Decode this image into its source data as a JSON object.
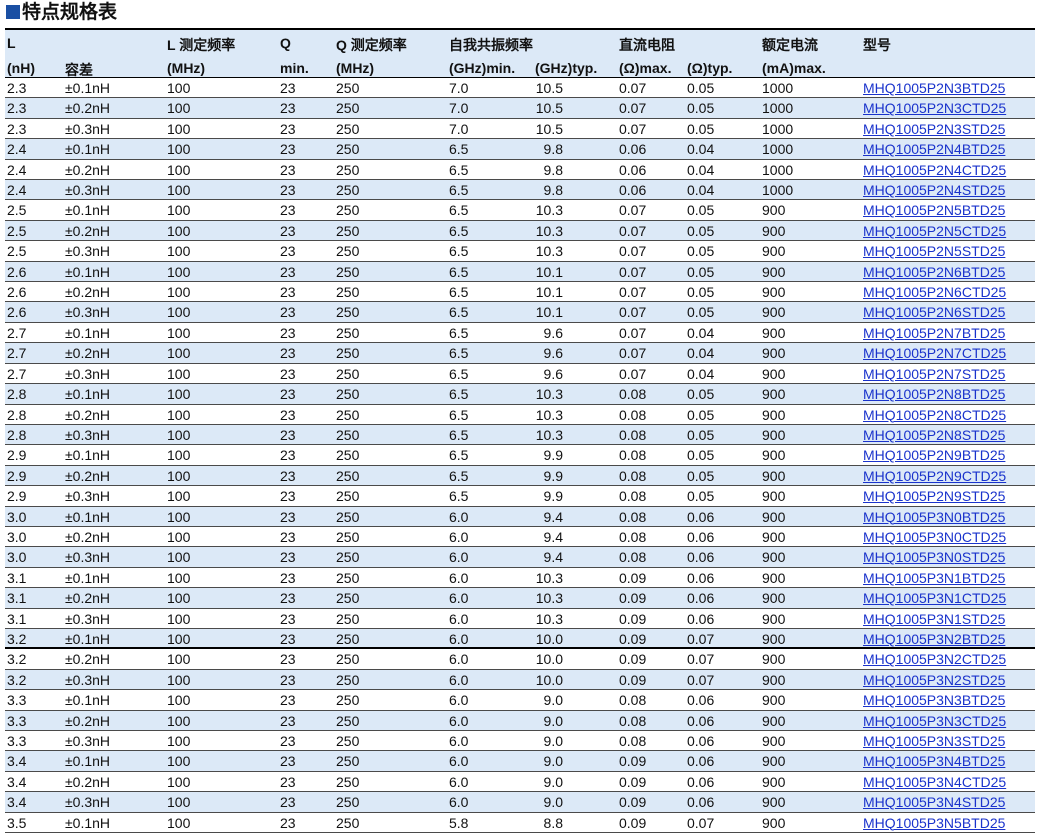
{
  "title": "特点规格表",
  "header": {
    "row1": {
      "l": "L",
      "l_freq": "L 测定频率",
      "q": "Q",
      "q_freq": "Q 测定频率",
      "srf": "自我共振频率",
      "dcr": "直流电阻",
      "rated": "额定电流",
      "part": "型号"
    },
    "row2": {
      "l_unit": "(nH)",
      "tol": "容差",
      "l_freq_unit": "(MHz)",
      "q_min": "min.",
      "q_freq_unit": "(MHz)",
      "srf_min": "(GHz)min.",
      "srf_typ": "(GHz)typ.",
      "dcr_max": "(Ω)max.",
      "dcr_typ": "(Ω)typ.",
      "rated_unit": "(mA)max."
    }
  },
  "rows": [
    [
      "2.3",
      "±0.1nH",
      "100",
      "23",
      "250",
      "7.0",
      "10.5",
      "0.07",
      "0.05",
      "1000",
      "MHQ1005P2N3BTD25"
    ],
    [
      "2.3",
      "±0.2nH",
      "100",
      "23",
      "250",
      "7.0",
      "10.5",
      "0.07",
      "0.05",
      "1000",
      "MHQ1005P2N3CTD25"
    ],
    [
      "2.3",
      "±0.3nH",
      "100",
      "23",
      "250",
      "7.0",
      "10.5",
      "0.07",
      "0.05",
      "1000",
      "MHQ1005P2N3STD25"
    ],
    [
      "2.4",
      "±0.1nH",
      "100",
      "23",
      "250",
      "6.5",
      "9.8",
      "0.06",
      "0.04",
      "1000",
      "MHQ1005P2N4BTD25"
    ],
    [
      "2.4",
      "±0.2nH",
      "100",
      "23",
      "250",
      "6.5",
      "9.8",
      "0.06",
      "0.04",
      "1000",
      "MHQ1005P2N4CTD25"
    ],
    [
      "2.4",
      "±0.3nH",
      "100",
      "23",
      "250",
      "6.5",
      "9.8",
      "0.06",
      "0.04",
      "1000",
      "MHQ1005P2N4STD25"
    ],
    [
      "2.5",
      "±0.1nH",
      "100",
      "23",
      "250",
      "6.5",
      "10.3",
      "0.07",
      "0.05",
      "900",
      "MHQ1005P2N5BTD25"
    ],
    [
      "2.5",
      "±0.2nH",
      "100",
      "23",
      "250",
      "6.5",
      "10.3",
      "0.07",
      "0.05",
      "900",
      "MHQ1005P2N5CTD25"
    ],
    [
      "2.5",
      "±0.3nH",
      "100",
      "23",
      "250",
      "6.5",
      "10.3",
      "0.07",
      "0.05",
      "900",
      "MHQ1005P2N5STD25"
    ],
    [
      "2.6",
      "±0.1nH",
      "100",
      "23",
      "250",
      "6.5",
      "10.1",
      "0.07",
      "0.05",
      "900",
      "MHQ1005P2N6BTD25"
    ],
    [
      "2.6",
      "±0.2nH",
      "100",
      "23",
      "250",
      "6.5",
      "10.1",
      "0.07",
      "0.05",
      "900",
      "MHQ1005P2N6CTD25"
    ],
    [
      "2.6",
      "±0.3nH",
      "100",
      "23",
      "250",
      "6.5",
      "10.1",
      "0.07",
      "0.05",
      "900",
      "MHQ1005P2N6STD25"
    ],
    [
      "2.7",
      "±0.1nH",
      "100",
      "23",
      "250",
      "6.5",
      "9.6",
      "0.07",
      "0.04",
      "900",
      "MHQ1005P2N7BTD25"
    ],
    [
      "2.7",
      "±0.2nH",
      "100",
      "23",
      "250",
      "6.5",
      "9.6",
      "0.07",
      "0.04",
      "900",
      "MHQ1005P2N7CTD25"
    ],
    [
      "2.7",
      "±0.3nH",
      "100",
      "23",
      "250",
      "6.5",
      "9.6",
      "0.07",
      "0.04",
      "900",
      "MHQ1005P2N7STD25"
    ],
    [
      "2.8",
      "±0.1nH",
      "100",
      "23",
      "250",
      "6.5",
      "10.3",
      "0.08",
      "0.05",
      "900",
      "MHQ1005P2N8BTD25"
    ],
    [
      "2.8",
      "±0.2nH",
      "100",
      "23",
      "250",
      "6.5",
      "10.3",
      "0.08",
      "0.05",
      "900",
      "MHQ1005P2N8CTD25"
    ],
    [
      "2.8",
      "±0.3nH",
      "100",
      "23",
      "250",
      "6.5",
      "10.3",
      "0.08",
      "0.05",
      "900",
      "MHQ1005P2N8STD25"
    ],
    [
      "2.9",
      "±0.1nH",
      "100",
      "23",
      "250",
      "6.5",
      "9.9",
      "0.08",
      "0.05",
      "900",
      "MHQ1005P2N9BTD25"
    ],
    [
      "2.9",
      "±0.2nH",
      "100",
      "23",
      "250",
      "6.5",
      "9.9",
      "0.08",
      "0.05",
      "900",
      "MHQ1005P2N9CTD25"
    ],
    [
      "2.9",
      "±0.3nH",
      "100",
      "23",
      "250",
      "6.5",
      "9.9",
      "0.08",
      "0.05",
      "900",
      "MHQ1005P2N9STD25"
    ],
    [
      "3.0",
      "±0.1nH",
      "100",
      "23",
      "250",
      "6.0",
      "9.4",
      "0.08",
      "0.06",
      "900",
      "MHQ1005P3N0BTD25"
    ],
    [
      "3.0",
      "±0.2nH",
      "100",
      "23",
      "250",
      "6.0",
      "9.4",
      "0.08",
      "0.06",
      "900",
      "MHQ1005P3N0CTD25"
    ],
    [
      "3.0",
      "±0.3nH",
      "100",
      "23",
      "250",
      "6.0",
      "9.4",
      "0.08",
      "0.06",
      "900",
      "MHQ1005P3N0STD25"
    ],
    [
      "3.1",
      "±0.1nH",
      "100",
      "23",
      "250",
      "6.0",
      "10.3",
      "0.09",
      "0.06",
      "900",
      "MHQ1005P3N1BTD25"
    ],
    [
      "3.1",
      "±0.2nH",
      "100",
      "23",
      "250",
      "6.0",
      "10.3",
      "0.09",
      "0.06",
      "900",
      "MHQ1005P3N1CTD25"
    ],
    [
      "3.1",
      "±0.3nH",
      "100",
      "23",
      "250",
      "6.0",
      "10.3",
      "0.09",
      "0.06",
      "900",
      "MHQ1005P3N1STD25"
    ],
    [
      "3.2",
      "±0.1nH",
      "100",
      "23",
      "250",
      "6.0",
      "10.0",
      "0.09",
      "0.07",
      "900",
      "MHQ1005P3N2BTD25"
    ],
    [
      "3.2",
      "±0.2nH",
      "100",
      "23",
      "250",
      "6.0",
      "10.0",
      "0.09",
      "0.07",
      "900",
      "MHQ1005P3N2CTD25"
    ],
    [
      "3.2",
      "±0.3nH",
      "100",
      "23",
      "250",
      "6.0",
      "10.0",
      "0.09",
      "0.07",
      "900",
      "MHQ1005P3N2STD25"
    ],
    [
      "3.3",
      "±0.1nH",
      "100",
      "23",
      "250",
      "6.0",
      "9.0",
      "0.08",
      "0.06",
      "900",
      "MHQ1005P3N3BTD25"
    ],
    [
      "3.3",
      "±0.2nH",
      "100",
      "23",
      "250",
      "6.0",
      "9.0",
      "0.08",
      "0.06",
      "900",
      "MHQ1005P3N3CTD25"
    ],
    [
      "3.3",
      "±0.3nH",
      "100",
      "23",
      "250",
      "6.0",
      "9.0",
      "0.08",
      "0.06",
      "900",
      "MHQ1005P3N3STD25"
    ],
    [
      "3.4",
      "±0.1nH",
      "100",
      "23",
      "250",
      "6.0",
      "9.0",
      "0.09",
      "0.06",
      "900",
      "MHQ1005P3N4BTD25"
    ],
    [
      "3.4",
      "±0.2nH",
      "100",
      "23",
      "250",
      "6.0",
      "9.0",
      "0.09",
      "0.06",
      "900",
      "MHQ1005P3N4CTD25"
    ],
    [
      "3.4",
      "±0.3nH",
      "100",
      "23",
      "250",
      "6.0",
      "9.0",
      "0.09",
      "0.06",
      "900",
      "MHQ1005P3N4STD25"
    ],
    [
      "3.5",
      "±0.1nH",
      "100",
      "23",
      "250",
      "5.8",
      "8.8",
      "0.09",
      "0.07",
      "900",
      "MHQ1005P3N5BTD25"
    ]
  ]
}
